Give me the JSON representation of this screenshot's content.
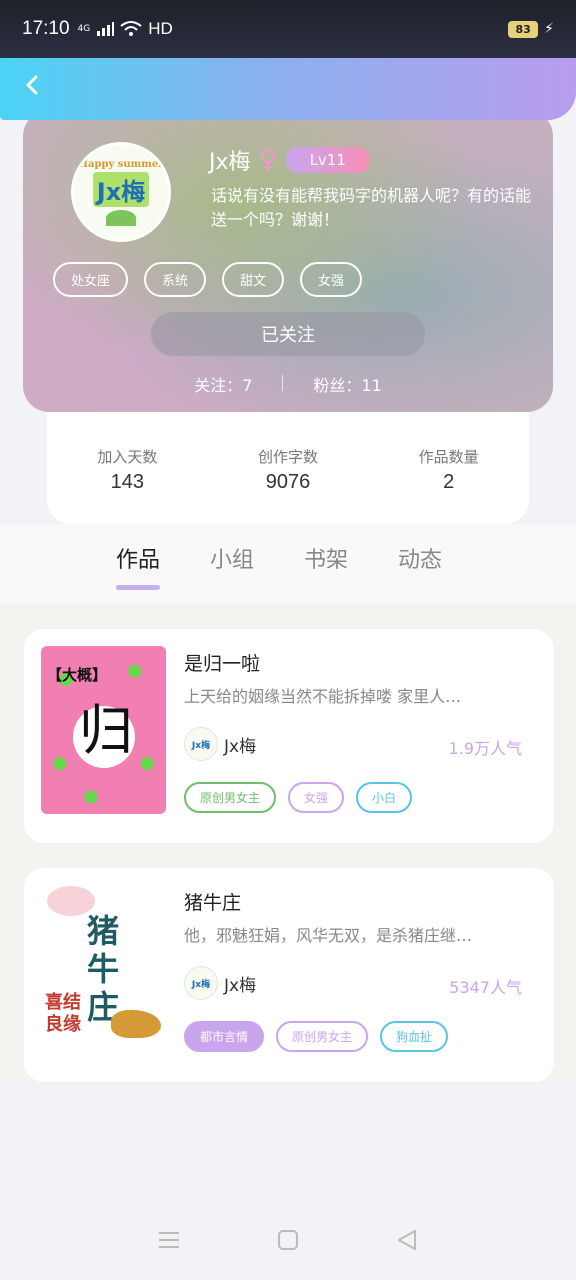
{
  "status_bar": {
    "time": "17:10",
    "network": "4G",
    "hd": "HD",
    "battery": "83"
  },
  "profile": {
    "username": "Jx梅",
    "avatar_text_top": "Happy summer",
    "avatar_text_main": "Jx梅",
    "level": "Lv11",
    "bio_line1": "话说有没有能帮我码字的机器人呢？有的话能",
    "bio_line2": "送一个吗？谢谢！",
    "tags": [
      "处女座",
      "系统",
      "甜文",
      "女强"
    ],
    "follow_button": "已关注",
    "following": "关注：7",
    "fans": "粉丝：11"
  },
  "stats": [
    {
      "label": "加入天数",
      "value": "143"
    },
    {
      "label": "创作字数",
      "value": "9076"
    },
    {
      "label": "作品数量",
      "value": "2"
    }
  ],
  "tabs": [
    "作品",
    "小组",
    "书架",
    "动态"
  ],
  "books": [
    {
      "title": "是归一啦",
      "desc": "上天给的姻缘当然不能拆掉喽  家里人…",
      "author": "Jx梅",
      "popularity": "1.9万人气",
      "cover_bracket": "【大概】",
      "cover_glyph": "归",
      "tags": [
        {
          "text": "原创男女主",
          "color": "#6fbe6a",
          "filled": false
        },
        {
          "text": "女强",
          "color": "#c9a5ee",
          "filled": false
        },
        {
          "text": "小白",
          "color": "#57c5e6",
          "filled": false
        }
      ]
    },
    {
      "title": "猪牛庄",
      "desc": "他，邪魅狂娟，风华无双，是杀猪庄继…",
      "author": "Jx梅",
      "popularity": "5347人气",
      "cover_title": "猪牛庄",
      "cover_red": "喜结良缘",
      "tags": [
        {
          "text": "都市言情",
          "color": "#c9a5ee",
          "filled": true
        },
        {
          "text": "原创男女主",
          "color": "#c9a5ee",
          "filled": false
        },
        {
          "text": "狗血扯",
          "color": "#57c5e6",
          "filled": false
        }
      ]
    }
  ],
  "colors": {
    "header_gradient_start": "#4ad3f5",
    "header_gradient_end": "#b89cee",
    "accent_purple": "#c5b0ee",
    "popularity": "#c7a6ec"
  }
}
